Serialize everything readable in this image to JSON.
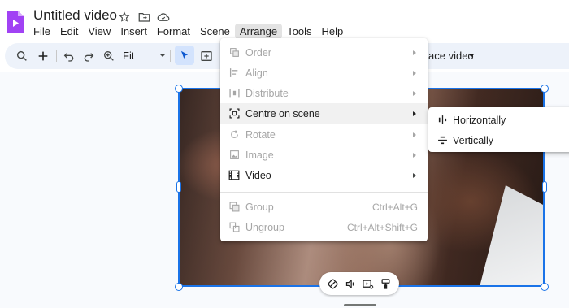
{
  "app": {
    "title": "Untitled video",
    "brand_color": "#a142f4"
  },
  "menubar": [
    "File",
    "Edit",
    "View",
    "Insert",
    "Format",
    "Scene",
    "Arrange",
    "Tools",
    "Help"
  ],
  "menubar_active": "Arrange",
  "toolbar": {
    "zoom_value": "Fit",
    "replace_label": "ace video"
  },
  "arrange_menu": {
    "items": [
      {
        "label": "Order",
        "icon": "order-icon",
        "submenu": true,
        "enabled": false
      },
      {
        "label": "Align",
        "icon": "align-icon",
        "submenu": true,
        "enabled": false
      },
      {
        "label": "Distribute",
        "icon": "distribute-icon",
        "submenu": true,
        "enabled": false
      },
      {
        "label": "Centre on scene",
        "icon": "centre-icon",
        "submenu": true,
        "enabled": true,
        "highlighted": true
      },
      {
        "label": "Rotate",
        "icon": "rotate-icon",
        "submenu": true,
        "enabled": false
      },
      {
        "label": "Image",
        "icon": "image-icon",
        "submenu": true,
        "enabled": false
      },
      {
        "label": "Video",
        "icon": "video-icon",
        "submenu": true,
        "enabled": true
      },
      {
        "label": "Group",
        "icon": "group-icon",
        "shortcut": "Ctrl+Alt+G",
        "enabled": false
      },
      {
        "label": "Ungroup",
        "icon": "ungroup-icon",
        "shortcut": "Ctrl+Alt+Shift+G",
        "enabled": false
      }
    ]
  },
  "centre_submenu": {
    "items": [
      {
        "label": "Horizontally",
        "icon": "centre-horizontal-icon"
      },
      {
        "label": "Vertically",
        "icon": "centre-vertical-icon"
      }
    ]
  },
  "colors": {
    "selection": "#1a73e8",
    "toolbar_bg": "#edf2fa",
    "disabled_text": "#a6a6a6"
  }
}
